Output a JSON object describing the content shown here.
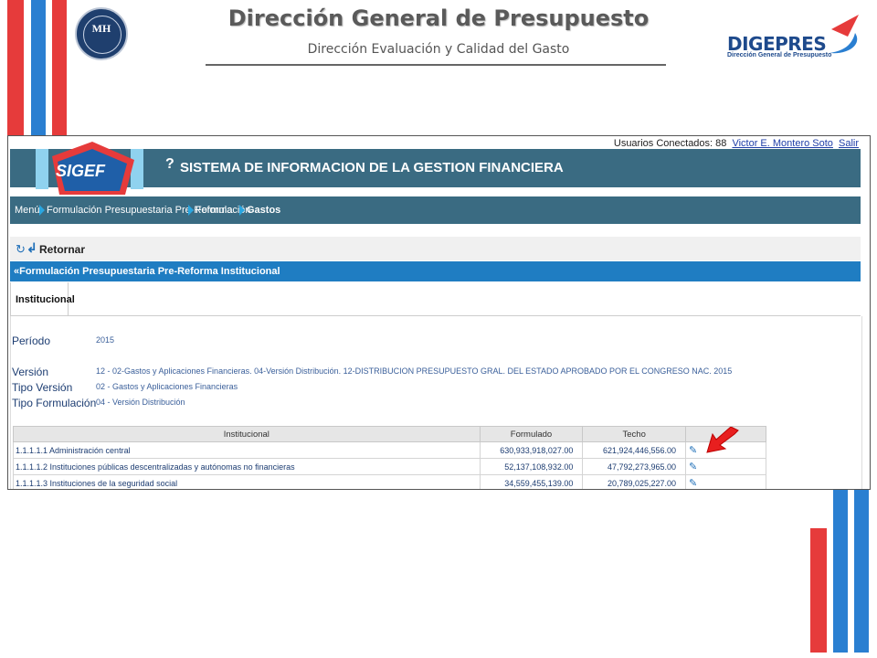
{
  "slide": {
    "title": "Dirección General de Presupuesto",
    "subtitle": "Dirección Evaluación y Calidad del Gasto",
    "seal_text": "MH",
    "logo_text": "DIGEPRES",
    "logo_sub": "Dirección General de Presupuesto"
  },
  "app": {
    "users_label": "Usuarios Conectados: 88",
    "user_name": "Victor E. Montero Soto",
    "logout_label": "Salir",
    "logo_label": "SIGEF",
    "help_glyph": "?",
    "title": "SISTEMA DE INFORMACION DE LA GESTION FINANCIERA"
  },
  "breadcrumb": {
    "items": [
      "Menú",
      "Formulación Presupuestaria Pre-Reforma",
      "Formulación",
      "Gastos"
    ]
  },
  "toolbar": {
    "back_label": "Retornar"
  },
  "section": {
    "title": "«Formulación Presupuestaria Pre-Reforma Institucional"
  },
  "tabs": [
    {
      "label": "Institucional"
    }
  ],
  "fields": {
    "periodo_label": "Período",
    "periodo_value": "2015",
    "version_label": "Versión",
    "version_value": "12 - 02-Gastos y Aplicaciones Financieras. 04-Versión Distribución. 12-DISTRIBUCION PRESUPUESTO GRAL. DEL ESTADO APROBADO POR EL CONGRESO NAC. 2015",
    "tipo_version_label": "Tipo Versión",
    "tipo_version_value": "02 - Gastos y Aplicaciones Financieras",
    "tipo_formulacion_label": "Tipo Formulación",
    "tipo_formulacion_value": "04 - Versión Distribución"
  },
  "table": {
    "headers": [
      "Institucional",
      "Formulado",
      "Techo",
      ""
    ],
    "rows": [
      {
        "institucional": "1.1.1.1.1 Administración central",
        "formulado": "630,933,918,027.00",
        "techo": "621,924,446,556.00"
      },
      {
        "institucional": "1.1.1.1.2 Instituciones públicas descentralizadas y autónomas no financieras",
        "formulado": "52,137,108,932.00",
        "techo": "47,792,273,965.00"
      },
      {
        "institucional": "1.1.1.1.3 Instituciones de la seguridad social",
        "formulado": "34,559,455,139.00",
        "techo": "20,789,025,227.00"
      }
    ]
  },
  "colors": {
    "stripe_red": "#e63b3b",
    "stripe_blue": "#2a7fd1",
    "banner": "#3a6b82",
    "section_bar": "#1f7dc2",
    "label_blue": "#1d3d72"
  },
  "icons": {
    "edit": "pencil-icon",
    "refresh": "refresh-icon",
    "back": "back-arrow-icon",
    "pointer": "red-arrow-icon"
  }
}
